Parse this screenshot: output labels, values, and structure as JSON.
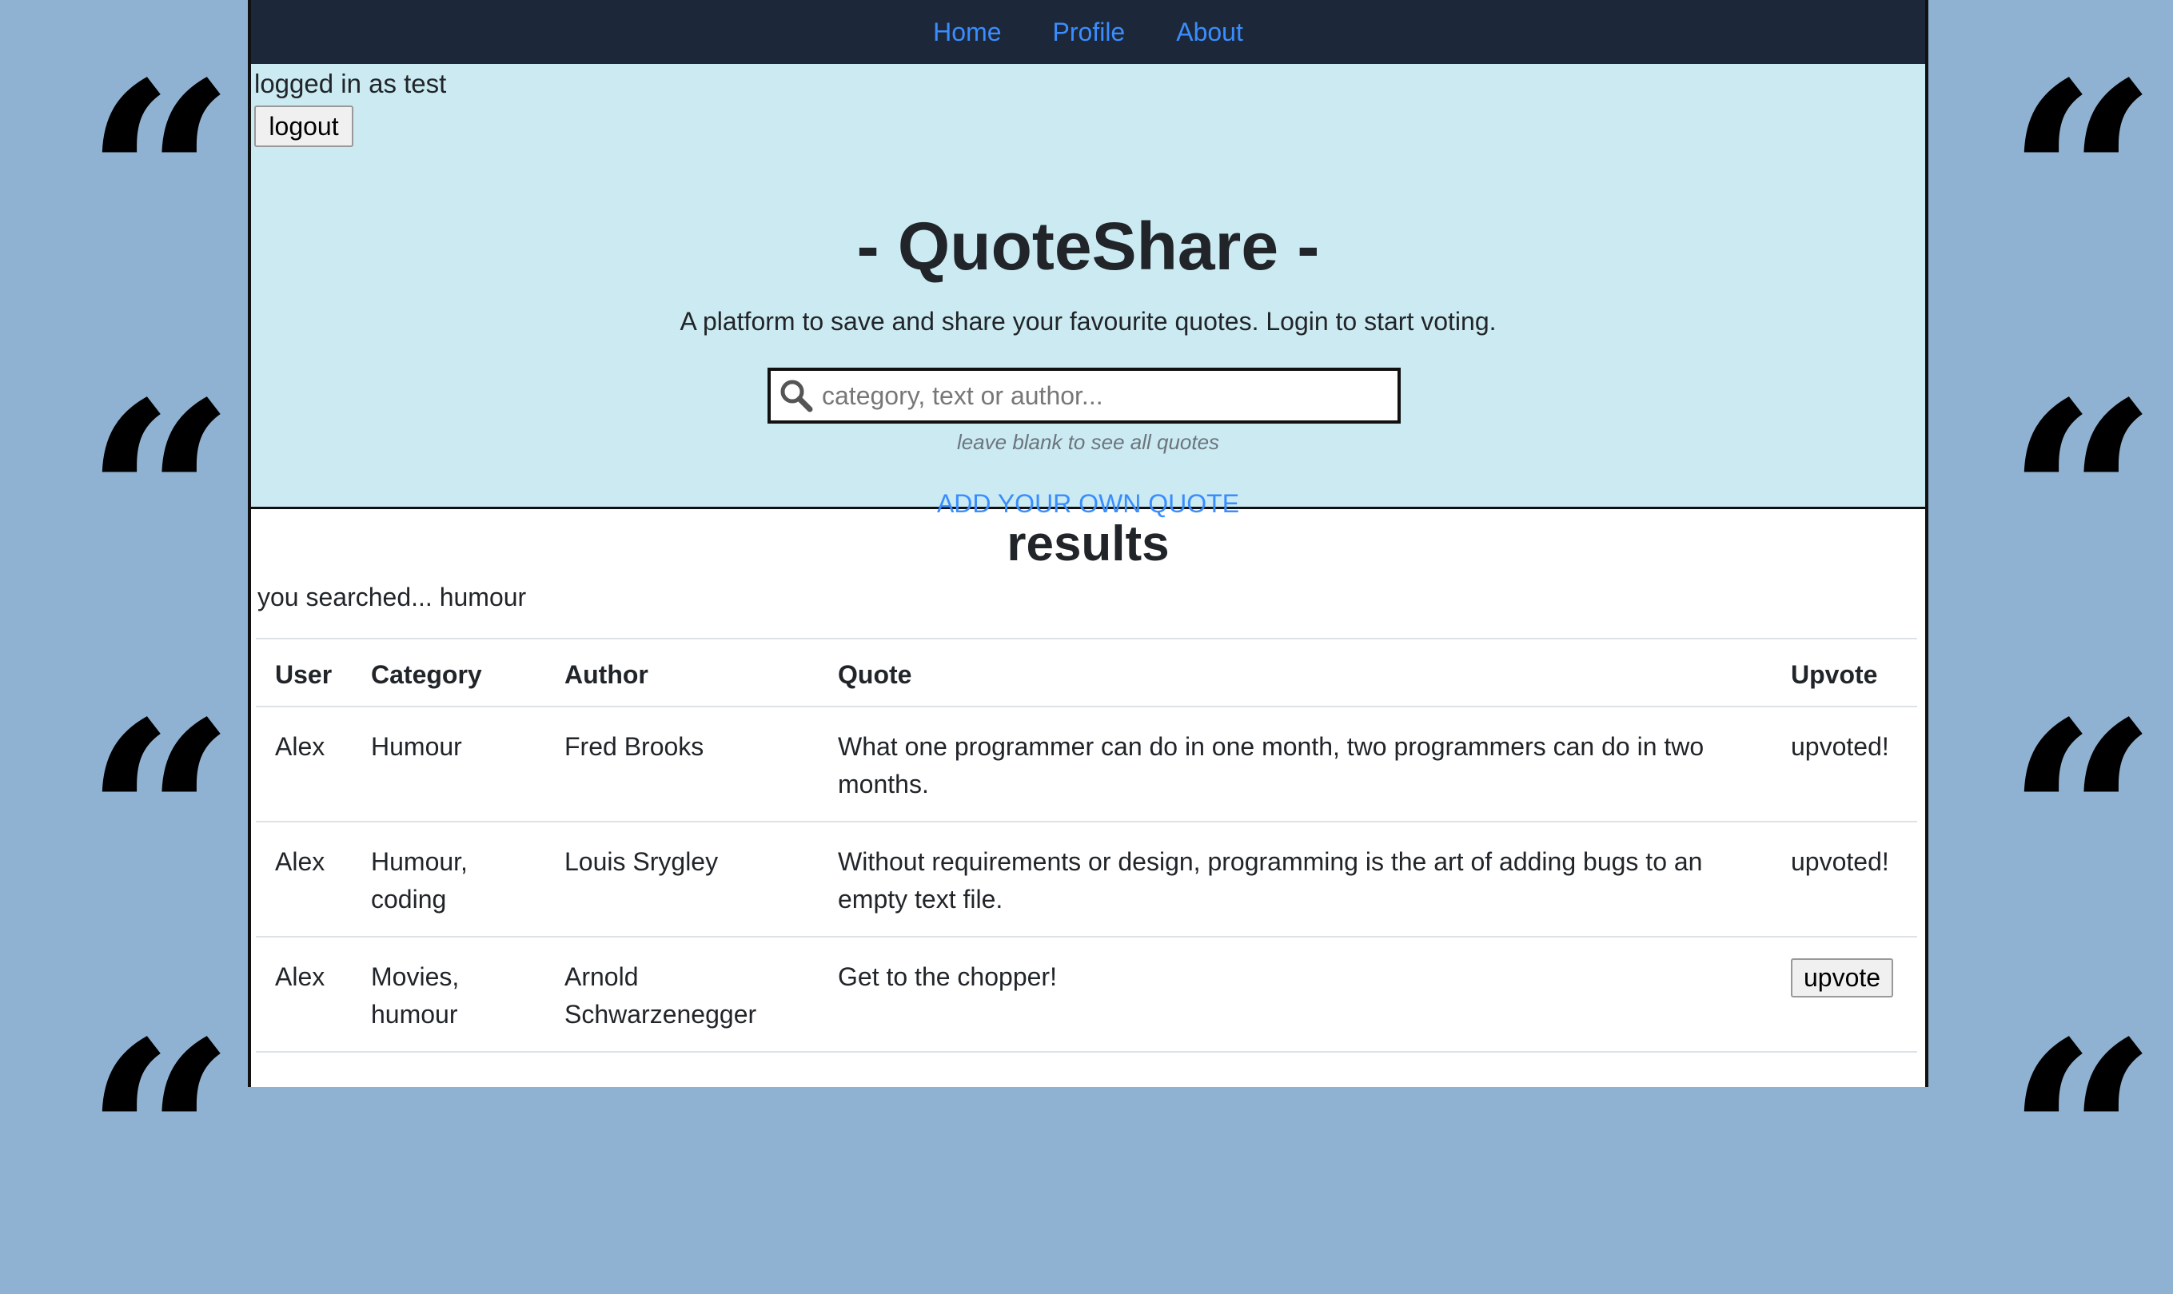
{
  "nav": {
    "items": [
      {
        "label": "Home"
      },
      {
        "label": "Profile"
      },
      {
        "label": "About"
      }
    ]
  },
  "session": {
    "status_text": "logged in as test",
    "logout_label": "logout"
  },
  "hero": {
    "title": "- QuoteShare -",
    "tagline": "A platform to save and share your favourite quotes. Login to start voting.",
    "search_placeholder": "category, text or author...",
    "search_hint": "leave blank to see all quotes",
    "add_quote_label": "ADD YOUR OWN QUOTE"
  },
  "results": {
    "title": "results",
    "search_summary": "you searched... humour",
    "columns": [
      "User",
      "Category",
      "Author",
      "Quote",
      "Upvote"
    ],
    "rows": [
      {
        "user": "Alex",
        "category": "Humour",
        "author": "Fred Brooks",
        "quote": "What one programmer can do in one month, two programmers can do in two months.",
        "upvote": "upvoted!"
      },
      {
        "user": "Alex",
        "category": "Humour, coding",
        "author": "Louis Srygley",
        "quote": "Without requirements or design, programming is the art of adding bugs to an empty text file.",
        "upvote": "upvoted!"
      },
      {
        "user": "Alex",
        "category": "Movies, humour",
        "author": "Arnold Schwarzenegger",
        "quote": "Get to the chopper!",
        "upvote": "upvote"
      }
    ]
  },
  "decor": {
    "quote_glyph": "“",
    "side_color": "#8fb2d2",
    "nav_color": "#1c2839",
    "hero_color": "#cbeaf2",
    "link_color": "#3a8dff"
  }
}
